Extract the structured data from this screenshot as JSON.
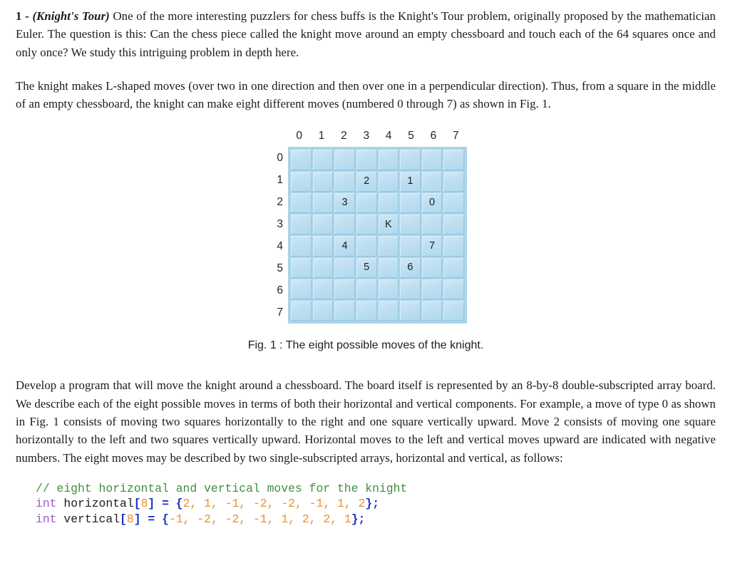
{
  "problem": {
    "number": "1 - ",
    "title": "(Knight's Tour)",
    "paragraph1": " One of the more interesting puzzlers for chess buffs is the Knight's Tour problem, originally proposed by the mathematician Euler. The question is this: Can the chess piece called the knight move around an empty chessboard and touch each of the 64 squares once and only once? We study this intriguing problem in depth here.",
    "paragraph2": "The knight makes L-shaped moves (over two in one direction and then over one in a perpendicular direction). Thus, from a square in the middle of an empty chessboard, the knight can make eight different moves (numbered 0 through 7) as shown in Fig. 1.",
    "paragraph3": "Develop a program that will move the knight around a chessboard. The board itself is represented by an 8-by-8 double-subscripted array board. We describe each of the eight possible moves in terms of both their horizontal and vertical components. For example, a move of type 0 as shown in Fig. 1 consists of moving two squares horizontally to the right and one square vertically upward. Move 2 consists of moving one square horizontally to the left and two squares vertically upward. Horizontal moves to the left and vertical moves upward are indicated with negative numbers. The eight moves may be described by two single-subscripted arrays, horizontal and vertical, as follows:"
  },
  "figure": {
    "caption": "Fig. 1 : The eight possible moves of the knight.",
    "column_labels": [
      "0",
      "1",
      "2",
      "3",
      "4",
      "5",
      "6",
      "7"
    ],
    "row_labels": [
      "0",
      "1",
      "2",
      "3",
      "4",
      "5",
      "6",
      "7"
    ],
    "board_colors": {
      "board_background": "#a9d3e9",
      "cell_fill": "#bfe0f2",
      "cell_highlight": "#cfe8f6",
      "cell_shadow": "#93c2de"
    },
    "knight_position": {
      "row": 3,
      "col": 4,
      "label": "K"
    },
    "cells": [
      [
        "",
        "",
        "",
        "",
        "",
        "",
        "",
        ""
      ],
      [
        "",
        "",
        "",
        "2",
        "",
        "1",
        "",
        ""
      ],
      [
        "",
        "",
        "3",
        "",
        "",
        "",
        "0",
        ""
      ],
      [
        "",
        "",
        "",
        "",
        "K",
        "",
        "",
        ""
      ],
      [
        "",
        "",
        "4",
        "",
        "",
        "",
        "7",
        ""
      ],
      [
        "",
        "",
        "",
        "5",
        "",
        "6",
        "",
        ""
      ],
      [
        "",
        "",
        "",
        "",
        "",
        "",
        "",
        ""
      ],
      [
        "",
        "",
        "",
        "",
        "",
        "",
        "",
        ""
      ]
    ],
    "moves": [
      {
        "id": "0",
        "row": 2,
        "col": 6
      },
      {
        "id": "1",
        "row": 1,
        "col": 5
      },
      {
        "id": "2",
        "row": 1,
        "col": 3
      },
      {
        "id": "3",
        "row": 2,
        "col": 2
      },
      {
        "id": "4",
        "row": 4,
        "col": 2
      },
      {
        "id": "5",
        "row": 5,
        "col": 3
      },
      {
        "id": "6",
        "row": 5,
        "col": 5
      },
      {
        "id": "7",
        "row": 4,
        "col": 6
      }
    ]
  },
  "code": {
    "language": "c",
    "colors": {
      "comment": "#3f8f3f",
      "keyword": "#9a5ad6",
      "punctuation": "#1a2fc4",
      "number": "#e8912a",
      "identifier": "#1d1d1d"
    },
    "line1": {
      "comment": "// eight horizontal and vertical moves for the knight"
    },
    "line2": {
      "keyword": "int",
      "identifier": " horizontal",
      "open_bracket": "[",
      "size": "8",
      "close_bracket": "]",
      "equals": " = ",
      "open_brace": "{",
      "values": "2, 1, -1, -2, -2, -1, 1, 2",
      "close_brace": "};"
    },
    "line3": {
      "keyword": "int",
      "identifier": " vertical",
      "open_bracket": "[",
      "size": "8",
      "close_bracket": "]",
      "equals": " = ",
      "open_brace": "{",
      "values": "-1, -2, -2, -1, 1, 2, 2, 1",
      "close_brace": "};"
    },
    "horizontal_array": [
      2,
      1,
      -1,
      -2,
      -2,
      -1,
      1,
      2
    ],
    "vertical_array": [
      -1,
      -2,
      -2,
      -1,
      1,
      2,
      2,
      1
    ]
  }
}
